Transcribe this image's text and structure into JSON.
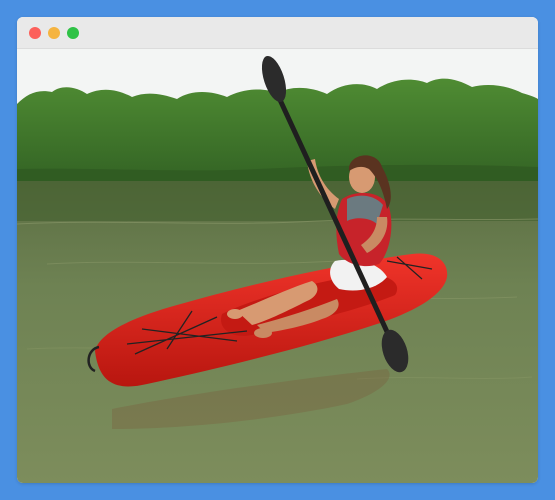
{
  "window": {
    "controls": [
      "close",
      "minimize",
      "maximize"
    ]
  },
  "photo": {
    "subject": "woman-paddling-red-kayak",
    "colors": {
      "sky": "#f3f5f4",
      "trees": "#3f7a2c",
      "water": "#6b7d4e",
      "kayak": "#e0261f",
      "paddle": "#2b2b2b"
    }
  }
}
